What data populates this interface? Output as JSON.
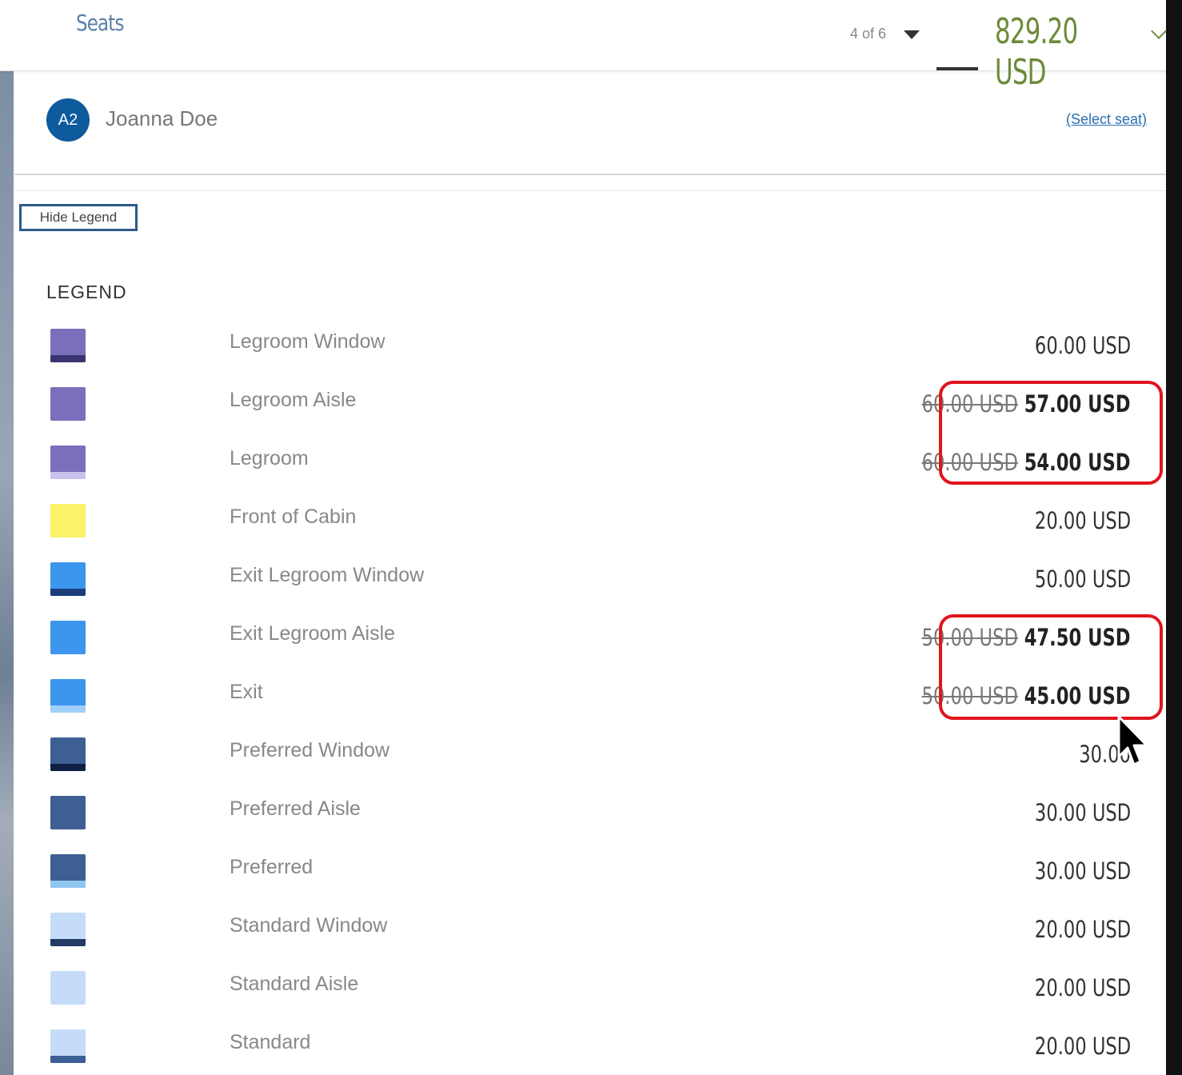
{
  "header": {
    "title": "Seats",
    "pager": "4 of 6",
    "total": "829.20 USD"
  },
  "passenger": {
    "initials": "A2",
    "name": "Joanna Doe",
    "select_link": "(Select seat)"
  },
  "legend": {
    "toggle_label": "Hide Legend",
    "title": "LEGEND",
    "items": [
      {
        "label": "Legroom Window",
        "price": "60.00 USD",
        "old_price": "",
        "color": "#7a6fba",
        "stripe": "#3a3470"
      },
      {
        "label": "Legroom Aisle",
        "price": "57.00 USD",
        "old_price": "60.00 USD",
        "color": "#7a6fba",
        "stripe": ""
      },
      {
        "label": "Legroom",
        "price": "54.00 USD",
        "old_price": "60.00 USD",
        "color": "#7a6fba",
        "stripe": "#c9c2ec"
      },
      {
        "label": "Front of Cabin",
        "price": "20.00 USD",
        "old_price": "",
        "color": "#fbf36a",
        "stripe": ""
      },
      {
        "label": "Exit Legroom Window",
        "price": "50.00 USD",
        "old_price": "",
        "color": "#3d96ee",
        "stripe": "#1a3c78"
      },
      {
        "label": "Exit Legroom Aisle",
        "price": "47.50 USD",
        "old_price": "50.00 USD",
        "color": "#3d96ee",
        "stripe": ""
      },
      {
        "label": "Exit",
        "price": "45.00 USD",
        "old_price": "50.00 USD",
        "color": "#3d96ee",
        "stripe": "#9fd0fa"
      },
      {
        "label": "Preferred Window",
        "price": "30.00",
        "old_price": "",
        "color": "#3e5f93",
        "stripe": "#0e1e44"
      },
      {
        "label": "Preferred Aisle",
        "price": "30.00 USD",
        "old_price": "",
        "color": "#3e5f93",
        "stripe": ""
      },
      {
        "label": "Preferred",
        "price": "30.00 USD",
        "old_price": "",
        "color": "#3e5f93",
        "stripe": "#8fc7f0"
      },
      {
        "label": "Standard Window",
        "price": "20.00 USD",
        "old_price": "",
        "color": "#c4dcf7",
        "stripe": "#233a66"
      },
      {
        "label": "Standard Aisle",
        "price": "20.00 USD",
        "old_price": "",
        "color": "#c4dcf7",
        "stripe": ""
      },
      {
        "label": "Standard",
        "price": "20.00 USD",
        "old_price": "",
        "color": "#c4dcf7",
        "stripe": "#3c5e96"
      }
    ]
  },
  "colors": {
    "highlight": "#e0151e",
    "total": "#6d8a3a",
    "avatar": "#0d5a9c"
  }
}
